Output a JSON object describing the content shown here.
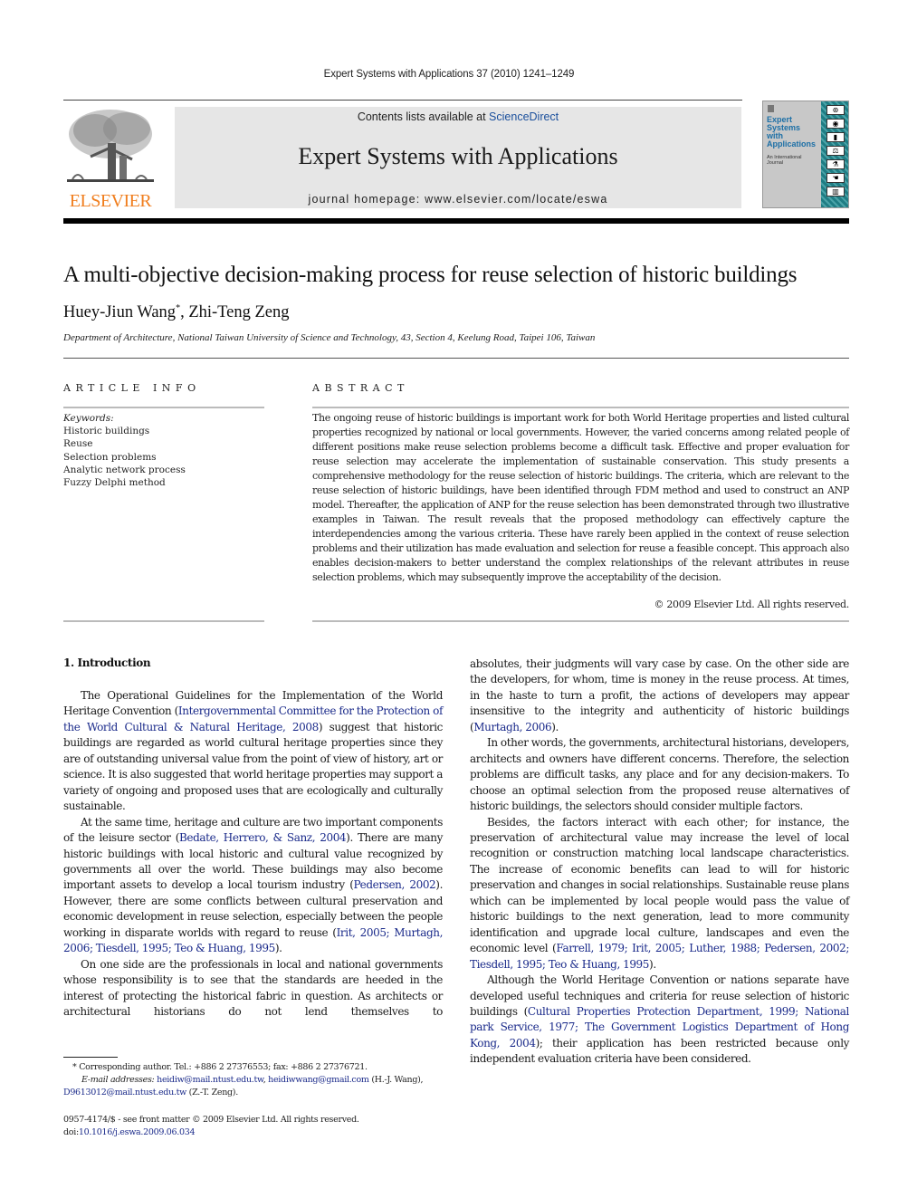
{
  "running_head": "Expert Systems with Applications 37 (2010) 1241–1249",
  "publisher": {
    "logo_word": "ELSEVIER",
    "brand_color": "#f07e1e"
  },
  "banner": {
    "contents_prefix": "Contents lists available at ",
    "contents_link": "ScienceDirect",
    "journal_title": "Expert Systems with Applications",
    "homepage": "journal homepage: www.elsevier.com/locate/eswa"
  },
  "cover": {
    "title_lines": [
      "Expert",
      "Systems",
      "with",
      "Applications"
    ],
    "subtitle": "An International Journal"
  },
  "article": {
    "title": "A multi-objective decision-making process for reuse selection of historic buildings",
    "author1": "Huey-Jiun Wang",
    "author1_mark": "*",
    "author_sep": ", ",
    "author2": "Zhi-Teng Zeng",
    "affiliation": "Department of Architecture, National Taiwan University of Science and Technology, 43, Section 4, Keelung Road, Taipei 106, Taiwan"
  },
  "article_info": {
    "heading": "ARTICLE INFO",
    "keywords_label": "Keywords:",
    "keywords": [
      "Historic buildings",
      "Reuse",
      "Selection problems",
      "Analytic network process",
      "Fuzzy Delphi method"
    ]
  },
  "abstract": {
    "heading": "ABSTRACT",
    "text": "The ongoing reuse of historic buildings is important work for both World Heritage properties and listed cultural properties recognized by national or local governments. However, the varied concerns among related people of different positions make reuse selection problems become a difficult task. Effective and proper evaluation for reuse selection may accelerate the implementation of sustainable conservation. This study presents a comprehensive methodology for the reuse selection of historic buildings. The criteria, which are relevant to the reuse selection of historic buildings, have been identified through FDM method and used to construct an ANP model. Thereafter, the application of ANP for the reuse selection has been demonstrated through two illustrative examples in Taiwan. The result reveals that the proposed methodology can effectively capture the interdependencies among the various criteria. These have rarely been applied in the context of reuse selection problems and their utilization has made evaluation and selection for reuse a feasible concept. This approach also enables decision-makers to better understand the complex relationships of the relevant attributes in reuse selection problems, which may subsequently improve the acceptability of the decision.",
    "copyright": "© 2009 Elsevier Ltd. All rights reserved."
  },
  "intro": {
    "heading": "1. Introduction",
    "p1": {
      "a": "The Operational Guidelines for the Implementation of the World Heritage Convention (",
      "cite1": "Intergovernmental Committee for the Protection of the World Cultural & Natural Heritage, 2008",
      "b": ") suggest that historic buildings are regarded as world cultural heritage properties since they are of outstanding universal value from the point of view of history, art or science. It is also suggested that world heritage properties may support a variety of ongoing and proposed uses that are ecologically and culturally sustainable."
    },
    "p2": {
      "a": "At the same time, heritage and culture are two important components of the leisure sector (",
      "cite1": "Bedate, Herrero, & Sanz, 2004",
      "b": "). There are many historic buildings with local historic and cultural value recognized by governments all over the world. These buildings may also become important assets to develop a local tourism industry (",
      "cite2": "Pedersen, 2002",
      "c": "). However, there are some conflicts between cultural preservation and economic development in reuse selection, especially between the people working in disparate worlds with regard to reuse (",
      "cite3": "Irit, 2005; Murtagh, 2006; Tiesdell, 1995; Teo & Huang, 1995",
      "d": ")."
    },
    "p3": {
      "a": "On one side are the professionals in local and national governments whose responsibility is to see that the standards are heeded in the interest of protecting the historical fabric in question. As architects or architectural historians do not lend themselves to"
    },
    "p3_cont": {
      "a": "absolutes, their judgments will vary case by case. On the other side are the developers, for whom, time is money in the reuse process. At times, in the haste to turn a profit, the actions of developers may appear insensitive to the integrity and authenticity of historic buildings (",
      "cite1": "Murtagh, 2006",
      "b": ")."
    },
    "p4": {
      "a": "In other words, the governments, architectural historians, developers, architects and owners have different concerns. Therefore, the selection problems are difficult tasks, any place and for any decision-makers. To choose an optimal selection from the proposed reuse alternatives of historic buildings, the selectors should consider multiple factors."
    },
    "p5": {
      "a": "Besides, the factors interact with each other; for instance, the preservation of architectural value may increase the level of local recognition or construction matching local landscape characteristics. The increase of economic benefits can lead to will for historic preservation and changes in social relationships. Sustainable reuse plans which can be implemented by local people would pass the value of historic buildings to the next generation, lead to more community identification and upgrade local culture, landscapes and even the economic level (",
      "cite1": "Farrell, 1979; Irit, 2005; Luther, 1988; Pedersen, 2002; Tiesdell, 1995; Teo & Huang, 1995",
      "b": ")."
    },
    "p6": {
      "a": "Although the World Heritage Convention or nations separate have developed useful techniques and criteria for reuse selection of historic buildings (",
      "cite1": "Cultural Properties Protection Department, 1999; National park Service, 1977; The Government Logistics Department of Hong Kong, 2004",
      "b": "); their application has been restricted because only independent evaluation criteria have been considered."
    }
  },
  "footnote": {
    "mark": "*",
    "line1": "Corresponding author. Tel.: +886 2 27376553; fax: +886 2 27376721.",
    "email_label": "E-mail addresses:",
    "email1": "heidiw@mail.ntust.edu.tw",
    "sep": ", ",
    "email2": "heidiwwang@gmail.com",
    "owner1": " (H.-J. Wang),",
    "email3": "D9613012@mail.ntust.edu.tw",
    "owner2": " (Z.-T. Zeng)."
  },
  "front_matter": {
    "issn_line": "0957-4174/$ - see front matter © 2009 Elsevier Ltd. All rights reserved.",
    "doi_prefix": "doi:",
    "doi": "10.1016/j.eswa.2009.06.034"
  }
}
